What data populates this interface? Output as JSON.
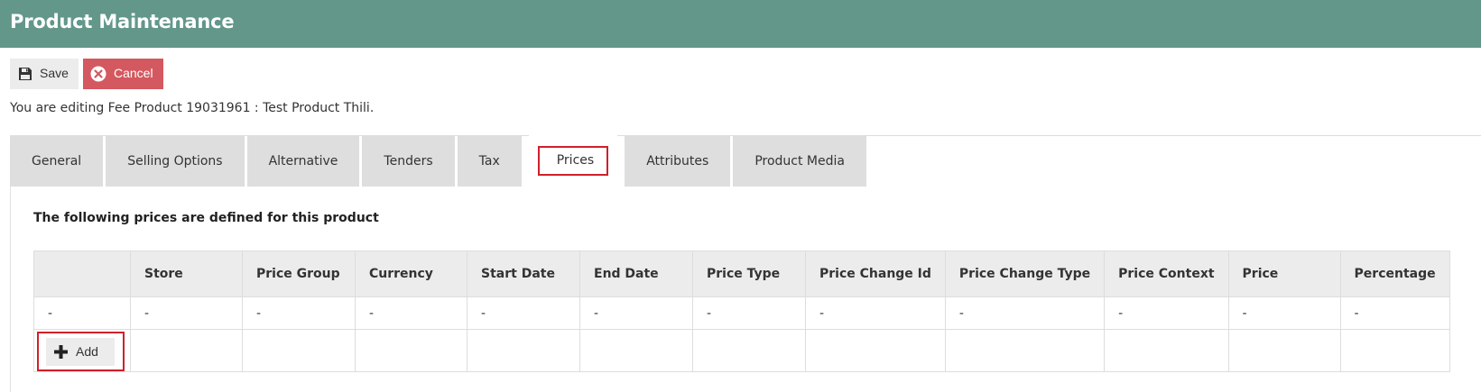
{
  "header": {
    "title": "Product Maintenance"
  },
  "toolbar": {
    "save_label": "Save",
    "cancel_label": "Cancel",
    "save_icon": "floppy-disk-icon",
    "cancel_icon": "circle-x-icon"
  },
  "info_text": "You are editing Fee Product 19031961 : Test Product Thili.",
  "tabs": [
    {
      "label": "General"
    },
    {
      "label": "Selling Options"
    },
    {
      "label": "Alternative"
    },
    {
      "label": "Tenders"
    },
    {
      "label": "Tax"
    },
    {
      "label": "Prices",
      "active": true
    },
    {
      "label": "Attributes"
    },
    {
      "label": "Product Media"
    }
  ],
  "prices": {
    "section_title": "The following prices are defined for this product",
    "columns": [
      "",
      "Store",
      "Price Group",
      "Currency",
      "Start Date",
      "End Date",
      "Price Type",
      "Price Change Id",
      "Price Change Type",
      "Price Context",
      "Price",
      "Percentage"
    ],
    "rows": [
      [
        "-",
        "-",
        "-",
        "-",
        "-",
        "-",
        "-",
        "-",
        "-",
        "-",
        "-",
        "-"
      ]
    ],
    "add_label": "Add",
    "add_icon": "plus-icon"
  },
  "colors": {
    "header_bg": "#62978a",
    "cancel_bg": "#d4585f",
    "highlight": "#d0202a"
  }
}
